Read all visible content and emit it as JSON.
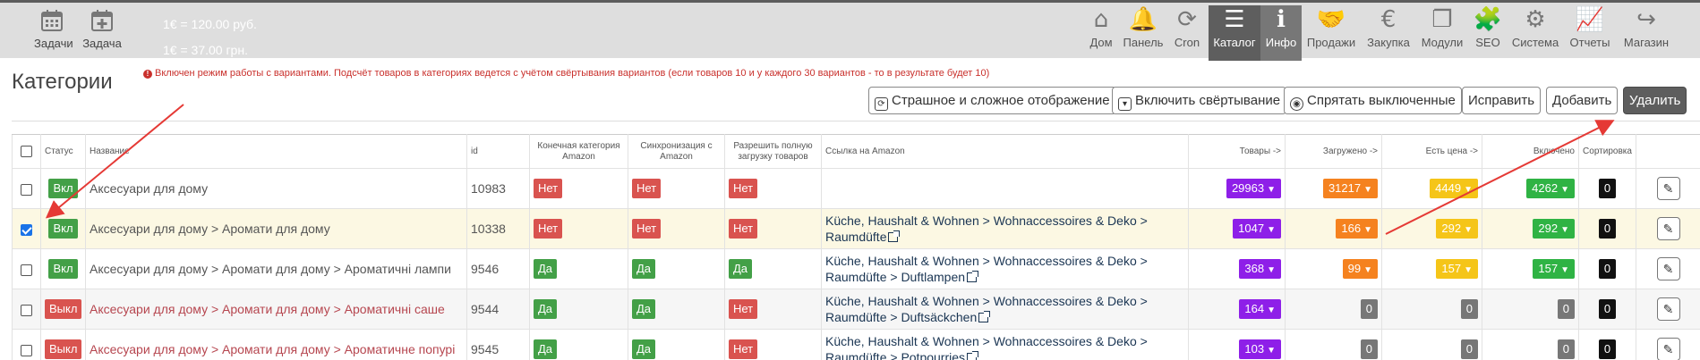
{
  "topbar": {
    "tools": [
      {
        "label": "Задачи",
        "icon": "calendar-icon"
      },
      {
        "label": "Задача",
        "icon": "calendar-plus-icon"
      }
    ],
    "rates": [
      "1€ = 120.00 руб.",
      "1€ = 37.00 грн."
    ],
    "nav": [
      {
        "label": "Дом",
        "icon": "home-icon",
        "glyph": "⌂"
      },
      {
        "label": "Панель",
        "icon": "bell-icon",
        "glyph": "🔔"
      },
      {
        "label": "Cron",
        "icon": "refresh-icon",
        "glyph": "⟳"
      },
      {
        "label": "Каталог",
        "icon": "list-icon",
        "glyph": "☰"
      },
      {
        "label": "Инфо",
        "icon": "info-icon",
        "glyph": "ℹ"
      },
      {
        "label": "Продажи",
        "icon": "handshake-icon",
        "glyph": "🤝"
      },
      {
        "label": "Закупка",
        "icon": "euro-icon",
        "glyph": "€"
      },
      {
        "label": "Модули",
        "icon": "copy-icon",
        "glyph": "❐"
      },
      {
        "label": "SEO",
        "icon": "puzzle-icon",
        "glyph": "🧩"
      },
      {
        "label": "Система",
        "icon": "cogs-icon",
        "glyph": "⚙"
      },
      {
        "label": "Отчеты",
        "icon": "area-chart-icon",
        "glyph": "📈"
      },
      {
        "label": "Магазин",
        "icon": "share-icon",
        "glyph": "↪"
      }
    ]
  },
  "page": {
    "title": "Категории",
    "notice": "Включен режим работы с вариантами. Подсчёт товаров в категориях ведется с учётом свёртывания вариантов (если товаров 10 и у каждого 30 вариантов - то в результате будет 10)"
  },
  "toolbar": {
    "scary_view": "Страшное и сложное отображение",
    "enable_collapse": "Включить свёртывание",
    "hide_disabled": "Спрятать выключенные",
    "fix": "Исправить",
    "add": "Добавить",
    "delete": "Удалить"
  },
  "table": {
    "headers": {
      "status": "Статус",
      "name": "Название",
      "id": "id",
      "final_category": "Конечная категория Amazon",
      "sync": "Синхронизация с Amazon",
      "allow_full": "Разрешить полную загрузку товаров",
      "amazon_link": "Ссылка на Amazon",
      "products": "Товары ->",
      "loaded": "Загружено ->",
      "has_price": "Есть цена ->",
      "enabled": "Включено",
      "sort": "Сортировка"
    },
    "rows": [
      {
        "checked": false,
        "status": "Вкл",
        "on": true,
        "name": "Аксесуари для дому",
        "id": "10983",
        "final": "Нет",
        "sync": "Нет",
        "full": "Нет",
        "link1": "",
        "link2": "",
        "products": "29963",
        "loaded": "31217",
        "price": "4449",
        "enabled": "4262",
        "sort": "0"
      },
      {
        "checked": true,
        "status": "Вкл",
        "on": true,
        "name": "Аксесуари для дому > Аромати для дому",
        "id": "10338",
        "final": "Нет",
        "sync": "Нет",
        "full": "Нет",
        "link1": "Küche, Haushalt & Wohnen > Wohnaccessoires & Deko >",
        "link2": "Raumdüfte",
        "products": "1047",
        "loaded": "166",
        "price": "292",
        "enabled": "292",
        "sort": "0"
      },
      {
        "checked": false,
        "status": "Вкл",
        "on": true,
        "name": "Аксесуари для дому > Аромати для дому > Ароматичні лампи",
        "id": "9546",
        "final": "Да",
        "sync": "Да",
        "full": "Да",
        "link1": "Küche, Haushalt & Wohnen > Wohnaccessoires & Deko >",
        "link2": "Raumdüfte > Duftlampen",
        "products": "368",
        "loaded": "99",
        "price": "157",
        "enabled": "157",
        "sort": "0"
      },
      {
        "checked": false,
        "status": "Выкл",
        "on": false,
        "name": "Аксесуари для дому > Аромати для дому > Ароматичні саше",
        "id": "9544",
        "final": "Да",
        "sync": "Да",
        "full": "Нет",
        "link1": "Küche, Haushalt & Wohnen > Wohnaccessoires & Deko >",
        "link2": "Raumdüfte > Duftsäckchen",
        "products": "164",
        "loaded": "0",
        "price": "0",
        "enabled": "0",
        "sort": "0"
      },
      {
        "checked": false,
        "status": "Выкл",
        "on": false,
        "name": "Аксесуари для дому > Аромати для дому > Ароматичне попурі",
        "id": "9545",
        "final": "Да",
        "sync": "Да",
        "full": "Нет",
        "link1": "Küche, Haushalt & Wohnen > Wohnaccessoires & Deko >",
        "link2": "Raumdüfte > Potpourries",
        "products": "103",
        "loaded": "0",
        "price": "0",
        "enabled": "0",
        "sort": "0"
      }
    ]
  },
  "colors": {
    "purple": "#8e1fe8",
    "orange": "#f5821f",
    "yellow": "#f5c518",
    "green": "#2fb344",
    "red": "#d9534f",
    "arrow": "#e53935"
  }
}
